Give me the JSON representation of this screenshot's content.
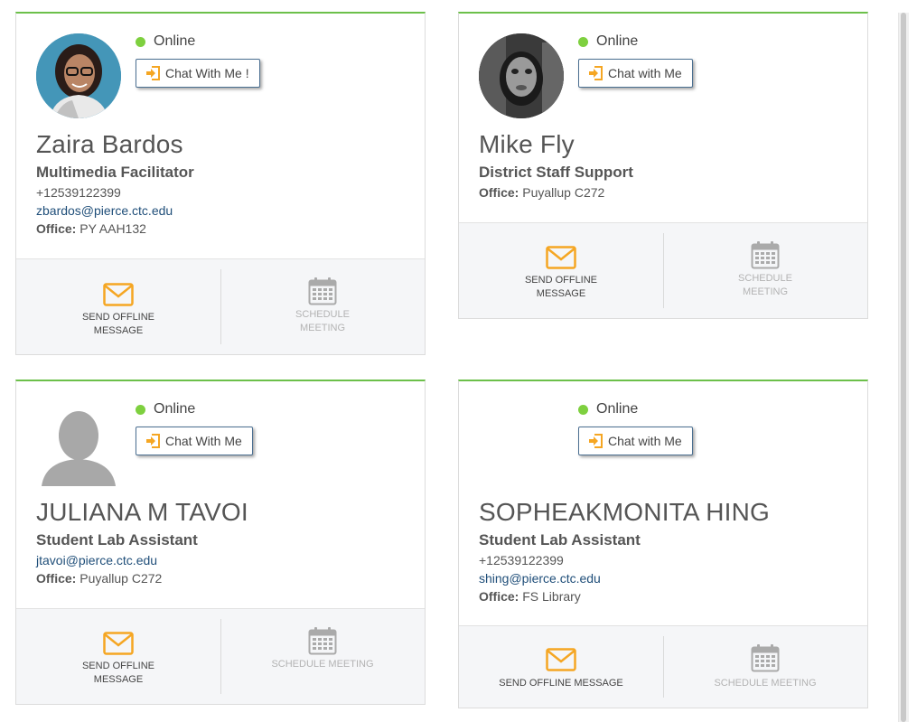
{
  "colors": {
    "accent_green": "#6cc04a",
    "online_dot": "#7ed03f",
    "envelope_orange": "#f5a623",
    "link_blue": "#1f4e79"
  },
  "cards": [
    {
      "status": "Online",
      "chat_label": "Chat With Me !",
      "name": "Zaira Bardos",
      "title": "Multimedia Facilitator",
      "phone": "+12539122399",
      "email": "zbardos@pierce.ctc.edu",
      "office_label": "Office:",
      "office": "PY AAH132",
      "send_line1": "SEND OFFLINE",
      "send_line2": "MESSAGE",
      "sched_line1": "SCHEDULE",
      "sched_line2": "MEETING",
      "avatar_icon": "photo-avatar"
    },
    {
      "status": "Online",
      "chat_label": "Chat with Me",
      "name": "Mike Fly",
      "title": "District Staff Support",
      "office_label": "Office:",
      "office": "Puyallup C272",
      "send_line1": "SEND OFFLINE",
      "send_line2": "MESSAGE",
      "sched_line1": "SCHEDULE",
      "sched_line2": "MEETING",
      "avatar_icon": "photo-avatar"
    },
    {
      "status": "Online",
      "chat_label": "Chat With Me",
      "name": "JULIANA M TAVOI",
      "title": "Student Lab Assistant",
      "email": "jtavoi@pierce.ctc.edu",
      "office_label": "Office:",
      "office": "Puyallup C272",
      "send_line1": "SEND OFFLINE",
      "send_line2": "MESSAGE",
      "sched_single": "SCHEDULE MEETING",
      "avatar_icon": "default-user-silhouette"
    },
    {
      "status": "Online",
      "chat_label": "Chat with Me",
      "name": "SOPHEAKMONITA HING",
      "title": "Student Lab Assistant",
      "phone": "+12539122399",
      "email": "shing@pierce.ctc.edu",
      "office_label": "Office:",
      "office": "FS Library",
      "send_single": "SEND OFFLINE MESSAGE",
      "sched_single": "SCHEDULE MEETING"
    }
  ]
}
